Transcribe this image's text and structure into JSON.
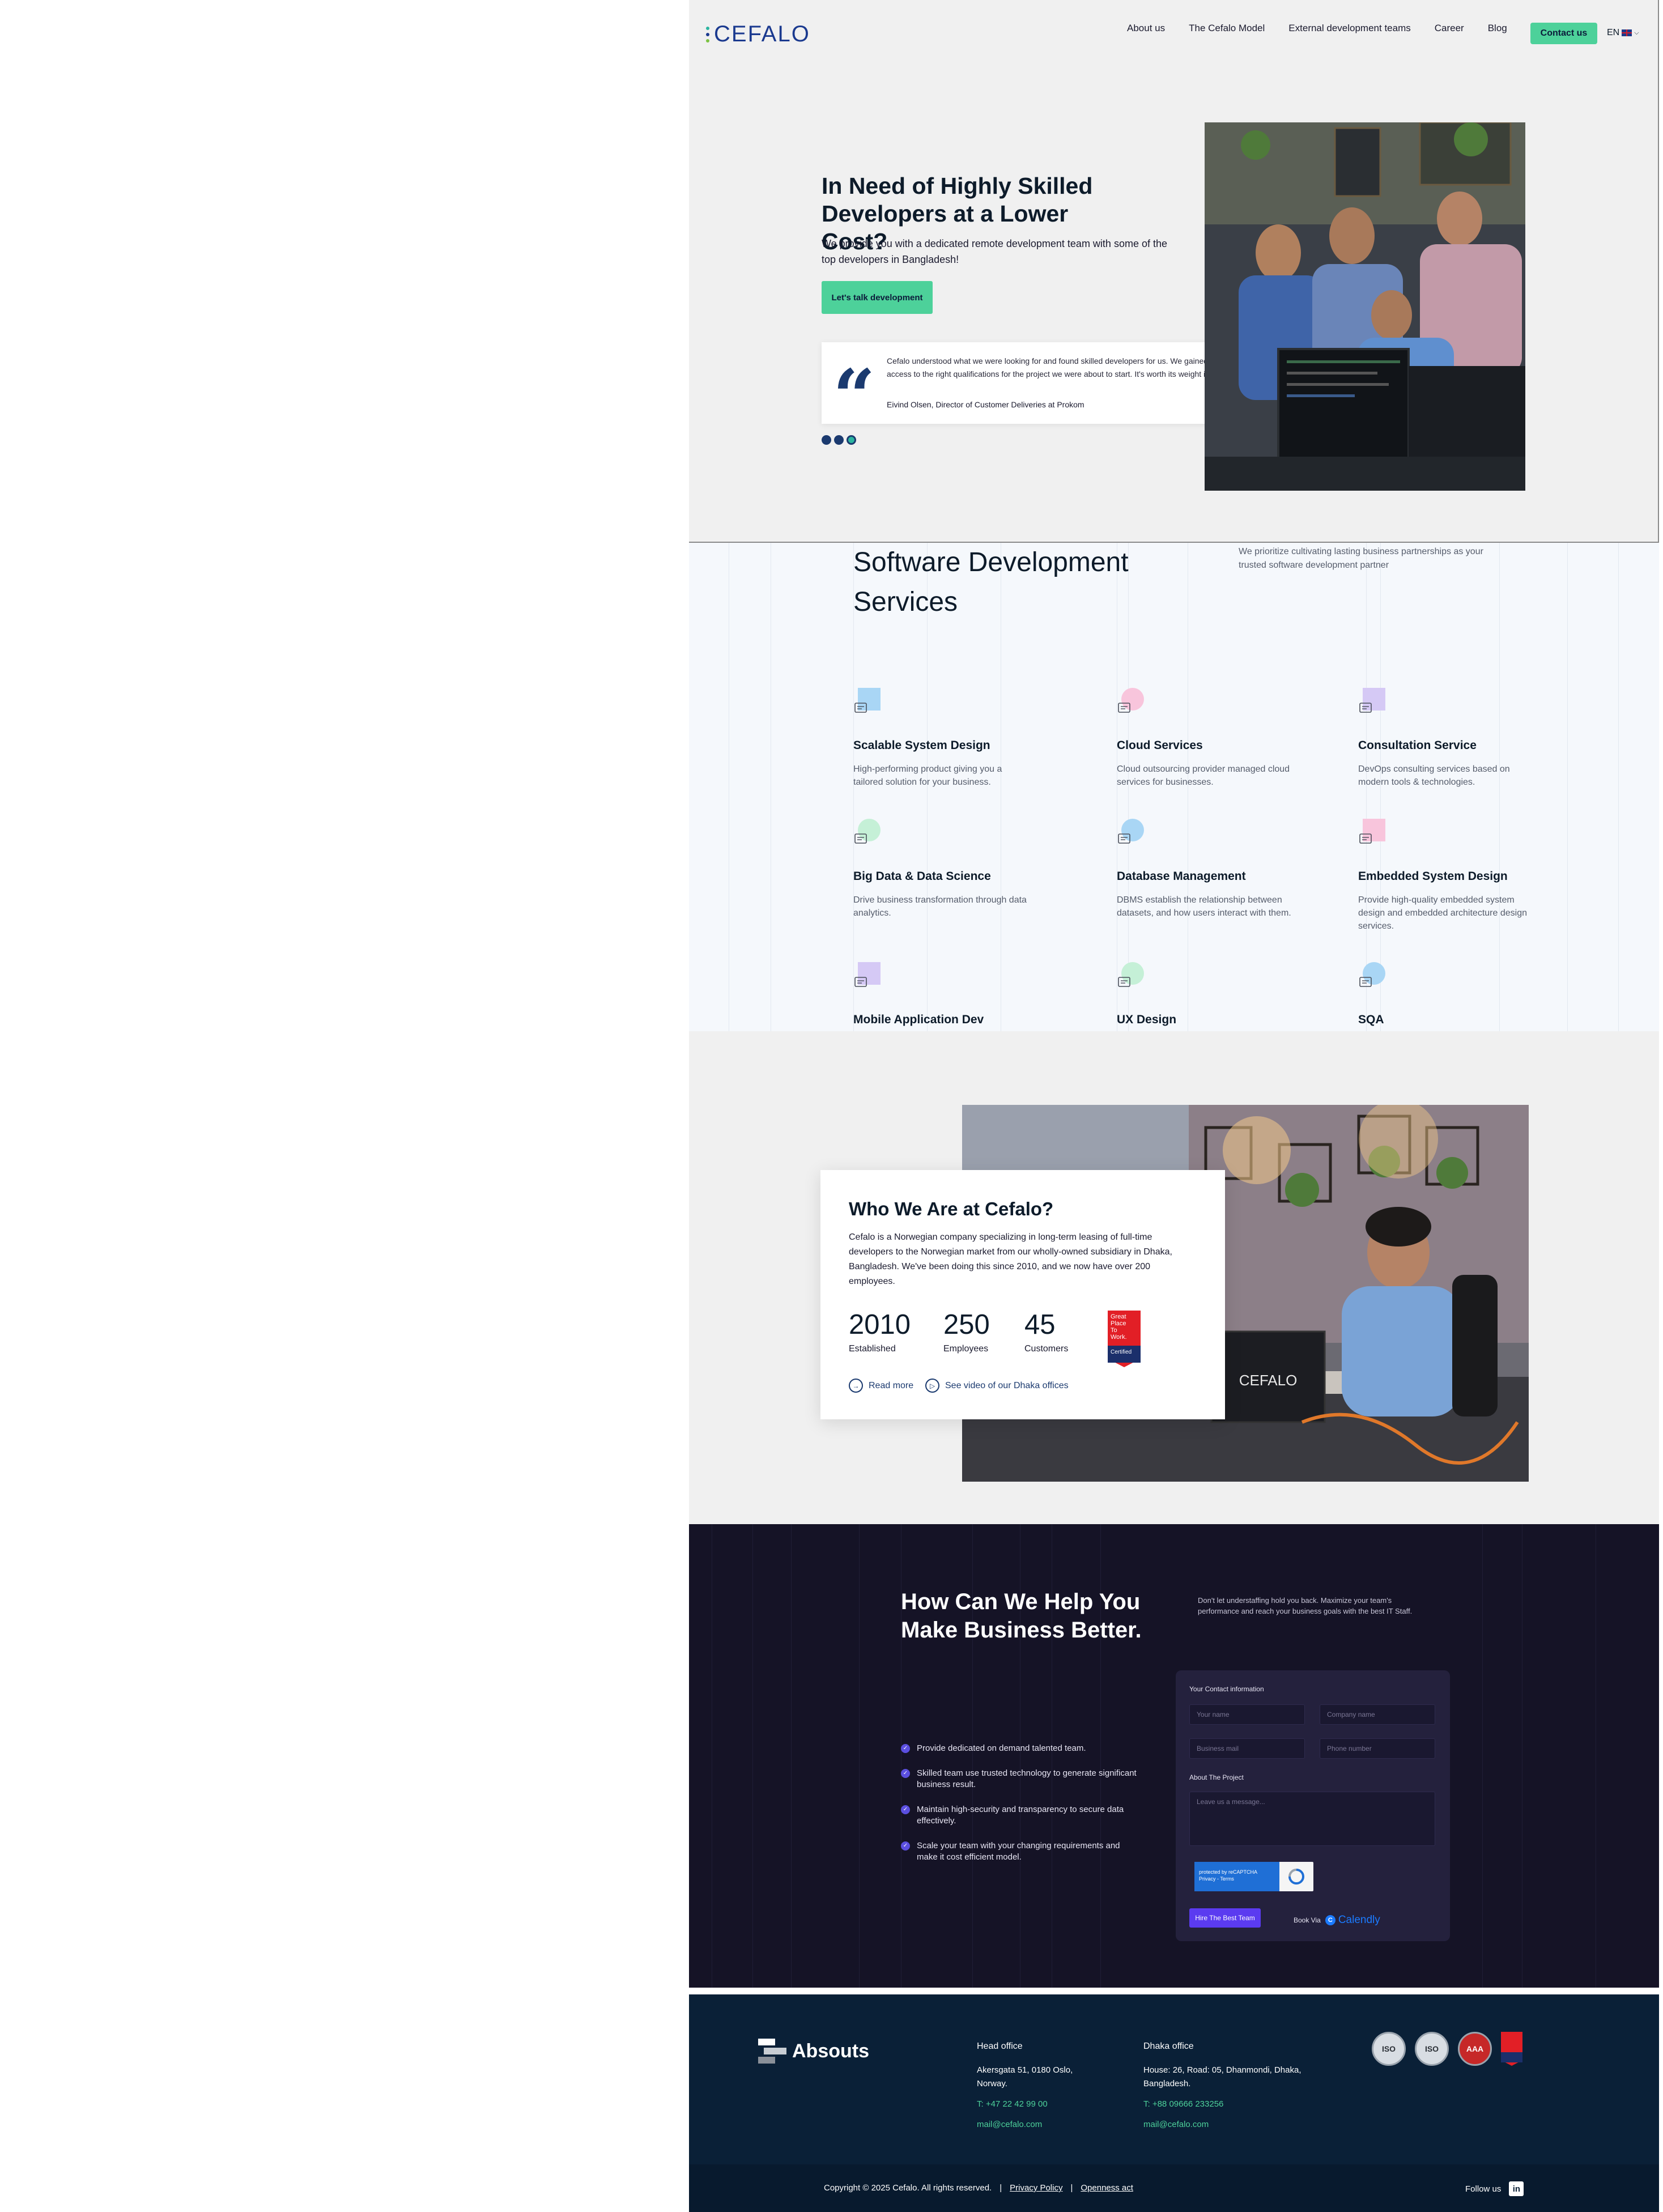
{
  "header": {
    "logo_text": "CEFALO",
    "nav": [
      "About us",
      "The Cefalo Model",
      "External development teams",
      "Career",
      "Blog"
    ],
    "contact_label": "Contact us",
    "lang_label": "EN"
  },
  "hero": {
    "title": "In Need of Highly Skilled Developers at a Lower Cost?",
    "subtitle": "We provide you with a dedicated remote development team with some of the top developers in Bangladesh!",
    "cta_label": "Let's talk development",
    "quote": "Cefalo understood what we were looking for and found skilled developers for us. We gained quick access to the right qualifications for the project we were about to start. It's worth its weight in gold!",
    "quote_author": "Eivind Olsen, Director of Customer Deliveries at Prokom"
  },
  "services": {
    "title": "Software Development Services",
    "intro": "We prioritize cultivating lasting business partnerships as your trusted software development partner",
    "items": [
      {
        "title": "Scalable System Design",
        "desc": "High-performing product giving you a tailored solution for your business.",
        "color": "#a9d6f5",
        "icon": "system-design-icon"
      },
      {
        "title": "Cloud Services",
        "desc": "Cloud outsourcing provider managed cloud services for businesses.",
        "color": "#f8c5dc",
        "icon": "cloud-icon"
      },
      {
        "title": "Consultation Service",
        "desc": "DevOps consulting services based on modern tools & technologies.",
        "color": "#d5c9f5",
        "icon": "consultation-icon"
      },
      {
        "title": "Big Data & Data Science",
        "desc": "Drive business transformation through data analytics.",
        "color": "#c5f0d7",
        "icon": "data-science-icon"
      },
      {
        "title": "Database Management",
        "desc": "DBMS establish the relationship between datasets, and how users interact with them.",
        "color": "#a9d6f5",
        "icon": "database-icon"
      },
      {
        "title": "Embedded System Design",
        "desc": "Provide high-quality embedded system design and embedded architecture design services.",
        "color": "#f8c5dc",
        "icon": "embedded-icon"
      },
      {
        "title": "Mobile Application Dev",
        "desc": "",
        "color": "#d5c9f5",
        "icon": "mobile-app-icon"
      },
      {
        "title": "UX Design",
        "desc": "",
        "color": "#c5f0d7",
        "icon": "ux-design-icon"
      },
      {
        "title": "SQA",
        "desc": "",
        "color": "#a9d6f5",
        "icon": "sqa-icon"
      }
    ]
  },
  "who": {
    "title": "Who We Are at Cefalo?",
    "text": "Cefalo is a Norwegian company specializing in long-term leasing of full-time developers to the Norwegian market from our wholly-owned subsidiary in Dhaka, Bangladesh. We've been doing this since 2010, and we now have over 200 employees.",
    "stats": [
      {
        "num": "2010",
        "label": "Established"
      },
      {
        "num": "250",
        "label": "Employees"
      },
      {
        "num": "45",
        "label": "Customers"
      }
    ],
    "badge_text": [
      "Great",
      "Place",
      "To",
      "Work.",
      "Certified"
    ],
    "read_more": "Read more",
    "video_link": "See video of our Dhaka offices",
    "laptop_text": "CEFALO"
  },
  "help": {
    "title": "How Can We Help You Make Business Better.",
    "intro": "Don't let understaffing hold you back. Maximize your team's performance and reach your business goals with the best IT Staff.",
    "bullets": [
      "Provide dedicated on demand talented team.",
      "Skilled team use trusted technology to generate significant business result.",
      "Maintain high-security and transparency to secure data effectively.",
      "Scale your team with your changing requirements and make it cost efficient model."
    ],
    "form": {
      "contact_label": "Your Contact information",
      "name_ph": "Your name",
      "company_ph": "Company name",
      "mail_ph": "Business mail",
      "phone_ph": "Phone number",
      "project_label": "About The Project",
      "message_ph": "Leave us a message...",
      "captcha_line1": "protected by reCAPTCHA",
      "captcha_line2": "Privacy - Terms",
      "submit_label": "Hire The Best Team",
      "book_label": "Book Via",
      "calendly_label": "Calendly"
    }
  },
  "footer": {
    "logo_text": "Absouts",
    "head_office": {
      "title": "Head office",
      "address": "Akersgata 51, 0180 Oslo, Norway.",
      "phone": "T: +47 22 42 99 00",
      "email": "mail@cefalo.com"
    },
    "dhaka_office": {
      "title": "Dhaka office",
      "address": "House: 26, Road: 05, Dhanmondi, Dhaka, Bangladesh.",
      "phone": "T: +88 09666 233256",
      "email": "mail@cefalo.com"
    },
    "badges": [
      "ISO",
      "ISO",
      "AAA"
    ],
    "copyright": "Copyright © 2025 Cefalo. All rights reserved.",
    "sep": "|",
    "privacy": "Privacy Policy",
    "openness": "Openness act",
    "follow": "Follow us"
  }
}
